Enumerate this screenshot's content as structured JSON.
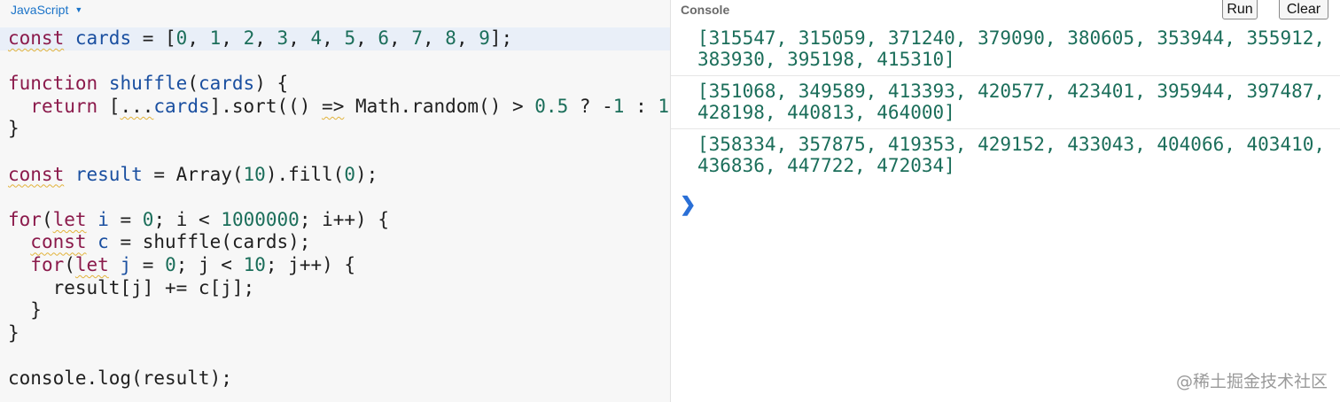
{
  "editor": {
    "language": "JavaScript",
    "code_lines": [
      "const cards = [0, 1, 2, 3, 4, 5, 6, 7, 8, 9];",
      "",
      "function shuffle(cards) {",
      "  return [...cards].sort(() => Math.random() > 0.5 ? -1 : 1",
      "}",
      "",
      "const result = Array(10).fill(0);",
      "",
      "for(let i = 0; i < 1000000; i++) {",
      "  const c = shuffle(cards);",
      "  for(let j = 0; j < 10; j++) {",
      "    result[j] += c[j];",
      "  }",
      "}",
      "",
      "console.log(result);"
    ]
  },
  "console": {
    "title": "Console",
    "run_label": "Run",
    "clear_label": "Clear",
    "prompt_symbol": "❯",
    "outputs": [
      {
        "row1": "[315547, 315059, 371240, 379090, 380605, 353944, 355912,",
        "row2": "383930, 395198, 415310]"
      },
      {
        "row1": "[351068, 349589, 413393, 420577, 423401, 395944, 397487,",
        "row2": "428198, 440813, 464000]"
      },
      {
        "row1": "[358334, 357875, 419353, 429152, 433043, 404066, 403410,",
        "row2": "436836, 447722, 472034]"
      }
    ]
  },
  "watermark": "@稀土掘金技术社区",
  "colors": {
    "keyword": "#8b1a4b",
    "identifier": "#1a4fa0",
    "number": "#1b6e5a",
    "bracket": "#b8860b",
    "accent": "#1a73c8"
  }
}
